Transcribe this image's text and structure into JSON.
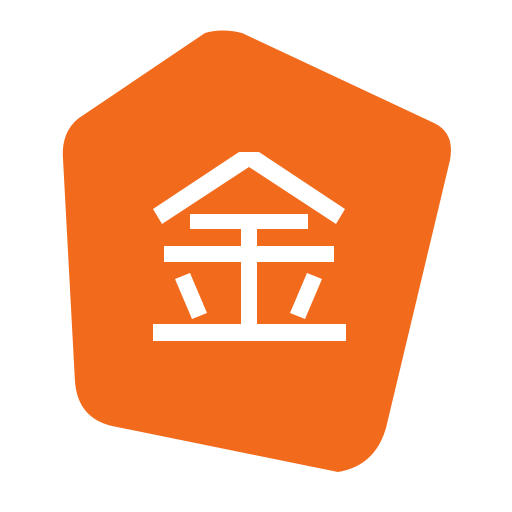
{
  "app_icon": {
    "glyph": "金",
    "colors": {
      "badge": "#F26A1B",
      "glyph": "#FFFFFF",
      "background": "#FFFFFF"
    }
  }
}
